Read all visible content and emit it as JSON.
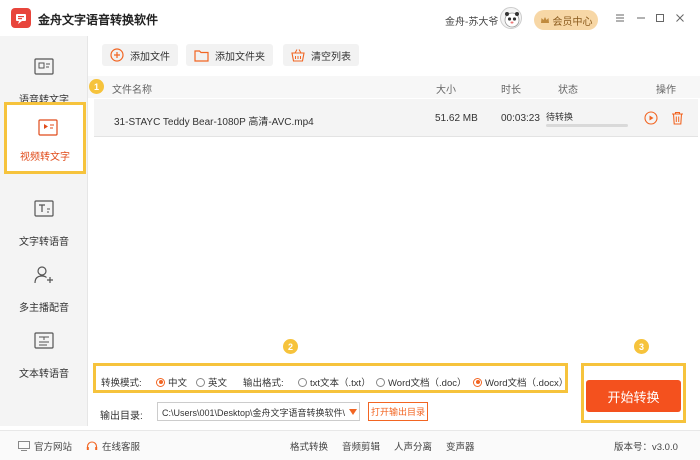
{
  "app": {
    "title": "金舟文字语音转换软件",
    "user_name": "金舟-苏大爷",
    "member_label": "会员中心"
  },
  "sidebar": {
    "items": [
      {
        "label": "语音转文字",
        "icon": "audio-to-text-icon"
      },
      {
        "label": "视频转文字",
        "icon": "video-to-text-icon"
      },
      {
        "label": "文字转语音",
        "icon": "text-to-audio-icon"
      },
      {
        "label": "多主播配音",
        "icon": "multi-voice-icon"
      },
      {
        "label": "文本转语音",
        "icon": "doc-to-audio-icon"
      }
    ]
  },
  "toolbar": {
    "add_file": "添加文件",
    "add_folder": "添加文件夹",
    "clear_list": "清空列表"
  },
  "table": {
    "headers": {
      "name": "文件名称",
      "size": "大小",
      "duration": "时长",
      "status": "状态",
      "action": "操作"
    },
    "rows": [
      {
        "name": "31-STAYC Teddy Bear-1080P 高清-AVC.mp4",
        "size": "51.62 MB",
        "duration": "00:03:23",
        "status": "待转换",
        "progress": 0
      }
    ]
  },
  "badges": {
    "one": "1",
    "two": "2",
    "three": "3"
  },
  "settings": {
    "mode_label": "转换模式:",
    "mode_options": [
      {
        "label": "中文",
        "selected": true
      },
      {
        "label": "英文",
        "selected": false
      }
    ],
    "format_label": "输出格式:",
    "format_options": [
      {
        "label": "txt文本（.txt）",
        "selected": false
      },
      {
        "label": "Word文档（.doc）",
        "selected": false
      },
      {
        "label": "Word文档（.docx）",
        "selected": true
      }
    ]
  },
  "output": {
    "label": "输出目录:",
    "path": "C:\\Users\\001\\Desktop\\金舟文字语音转换软件\\",
    "open_label": "打开输出目录"
  },
  "start_label": "开始转换",
  "footer": {
    "website": "官方网站",
    "service": "在线客服",
    "links": [
      "格式转换",
      "音频剪辑",
      "人声分离",
      "变声器"
    ],
    "version": "版本号：v3.0.0"
  },
  "colors": {
    "accent": "#f4511e",
    "highlight": "#f6c33c",
    "logo": "#e8453c"
  }
}
